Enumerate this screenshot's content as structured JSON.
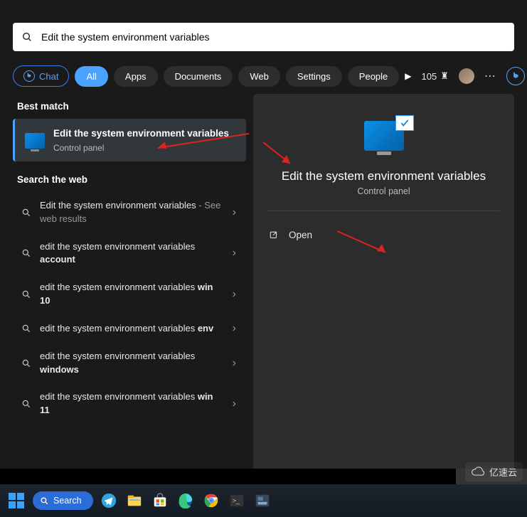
{
  "search": {
    "query": "Edit the system environment variables"
  },
  "filters": {
    "chat": "Chat",
    "tabs": [
      "All",
      "Apps",
      "Documents",
      "Web",
      "Settings",
      "People"
    ],
    "active_index": 0,
    "points": "105"
  },
  "best_match": {
    "heading": "Best match",
    "title": "Edit the system environment variables",
    "subtitle": "Control panel"
  },
  "web_search": {
    "heading": "Search the web",
    "items": [
      {
        "prefix": "Edit the system environment variables",
        "bold": "",
        "suffix": " - See web results"
      },
      {
        "prefix": "edit the system environment variables ",
        "bold": "account",
        "suffix": ""
      },
      {
        "prefix": "edit the system environment variables ",
        "bold": "win 10",
        "suffix": ""
      },
      {
        "prefix": "edit the system environment variables ",
        "bold": "env",
        "suffix": ""
      },
      {
        "prefix": "edit the system environment variables ",
        "bold": "windows",
        "suffix": ""
      },
      {
        "prefix": "edit the system environment variables ",
        "bold": "win 11",
        "suffix": ""
      }
    ]
  },
  "preview": {
    "title": "Edit the system environment variables",
    "subtitle": "Control panel",
    "open_label": "Open"
  },
  "taskbar": {
    "search_label": "Search"
  },
  "watermark": "亿速云"
}
